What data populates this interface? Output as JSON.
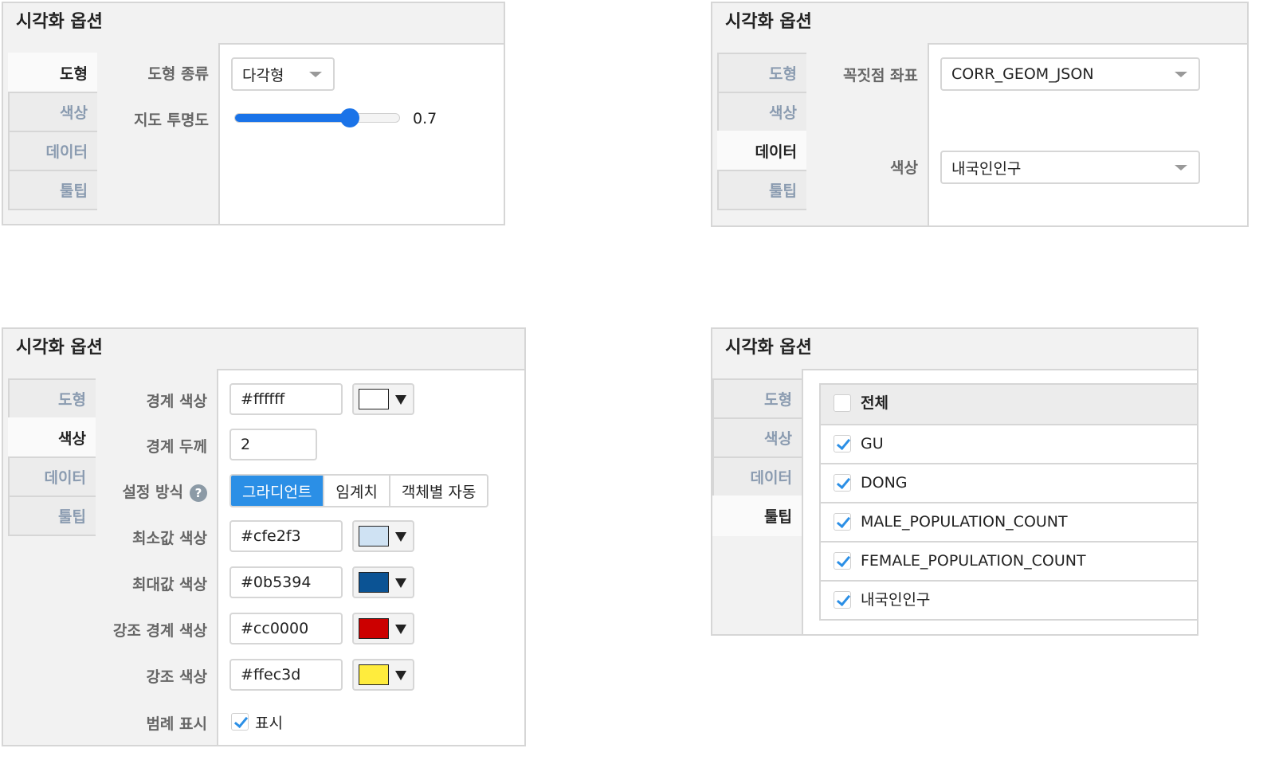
{
  "panel_title": "시각화 옵션",
  "tabs": [
    "도형",
    "색상",
    "데이터",
    "툴팁"
  ],
  "panel1": {
    "shape_type_label": "도형 종류",
    "shape_type_value": "다각형",
    "opacity_label": "지도 투명도",
    "opacity_value": "0.7",
    "opacity_fraction": 0.7
  },
  "panel2": {
    "vertex_label": "꼭짓점 좌표",
    "vertex_value": "CORR_GEOM_JSON",
    "color_label": "색상",
    "color_value": "내국인인구"
  },
  "panel3": {
    "border_color_label": "경계 색상",
    "border_color_value": "#ffffff",
    "border_width_label": "경계 두께",
    "border_width_value": "2",
    "method_label": "설정 방식",
    "help_symbol": "?",
    "method_options": [
      "그라디언트",
      "임계치",
      "객체별 자동"
    ],
    "method_selected": "그라디언트",
    "min_color_label": "최소값 색상",
    "min_color_value": "#cfe2f3",
    "max_color_label": "최대값 색상",
    "max_color_value": "#0b5394",
    "hl_border_label": "강조 경계 색상",
    "hl_border_value": "#cc0000",
    "hl_color_label": "강조 색상",
    "hl_color_value": "#ffec3d",
    "legend_label": "범례 표시",
    "legend_checkbox_label": "표시",
    "legend_checked": true
  },
  "panel4": {
    "all_label": "전체",
    "all_checked": false,
    "fields": [
      {
        "label": "GU",
        "checked": true
      },
      {
        "label": "DONG",
        "checked": true
      },
      {
        "label": "MALE_POPULATION_COUNT",
        "checked": true
      },
      {
        "label": "FEMALE_POPULATION_COUNT",
        "checked": true
      },
      {
        "label": "내국인인구",
        "checked": true
      }
    ]
  },
  "colors": {
    "accent": "#2b8fe6",
    "slider": "#1a73e8",
    "tab_inactive_text": "#8a9bb0"
  }
}
